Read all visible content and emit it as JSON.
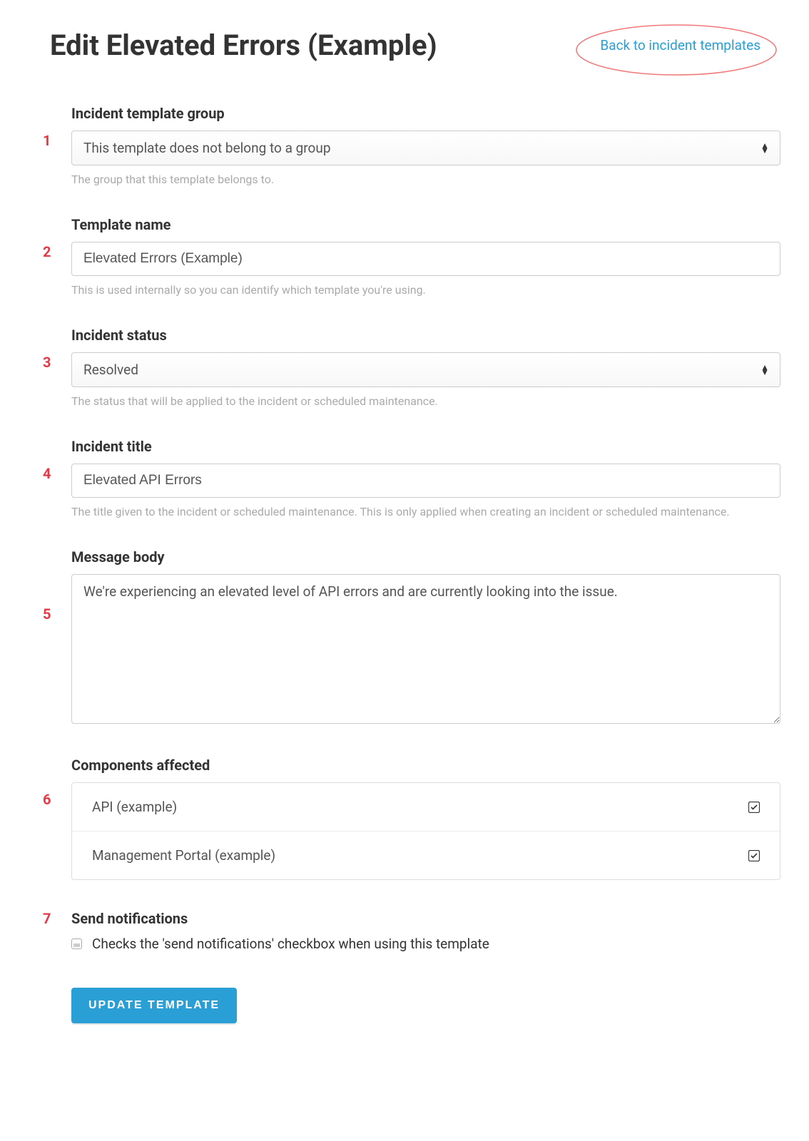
{
  "header": {
    "title": "Edit Elevated Errors (Example)",
    "back_link": "Back to incident templates"
  },
  "markers": [
    "1",
    "2",
    "3",
    "4",
    "5",
    "6",
    "7"
  ],
  "template_group": {
    "label": "Incident template group",
    "value": "This template does not belong to a group",
    "help": "The group that this template belongs to."
  },
  "template_name": {
    "label": "Template name",
    "value": "Elevated Errors (Example)",
    "help": "This is used internally so you can identify which template you're using."
  },
  "incident_status": {
    "label": "Incident status",
    "value": "Resolved",
    "help": "The status that will be applied to the incident or scheduled maintenance."
  },
  "incident_title": {
    "label": "Incident title",
    "value": "Elevated API Errors",
    "help": "The title given to the incident or scheduled maintenance. This is only applied when creating an incident or scheduled maintenance."
  },
  "message_body": {
    "label": "Message body",
    "value": "We're experiencing an elevated level of API errors and are currently looking into the issue."
  },
  "components": {
    "label": "Components affected",
    "items": [
      {
        "name": "API (example)",
        "checked": true
      },
      {
        "name": "Management Portal (example)",
        "checked": true
      }
    ]
  },
  "notifications": {
    "label": "Send notifications",
    "text": "Checks the 'send notifications' checkbox when using this template",
    "checked": false
  },
  "submit": {
    "label": "UPDATE TEMPLATE"
  }
}
